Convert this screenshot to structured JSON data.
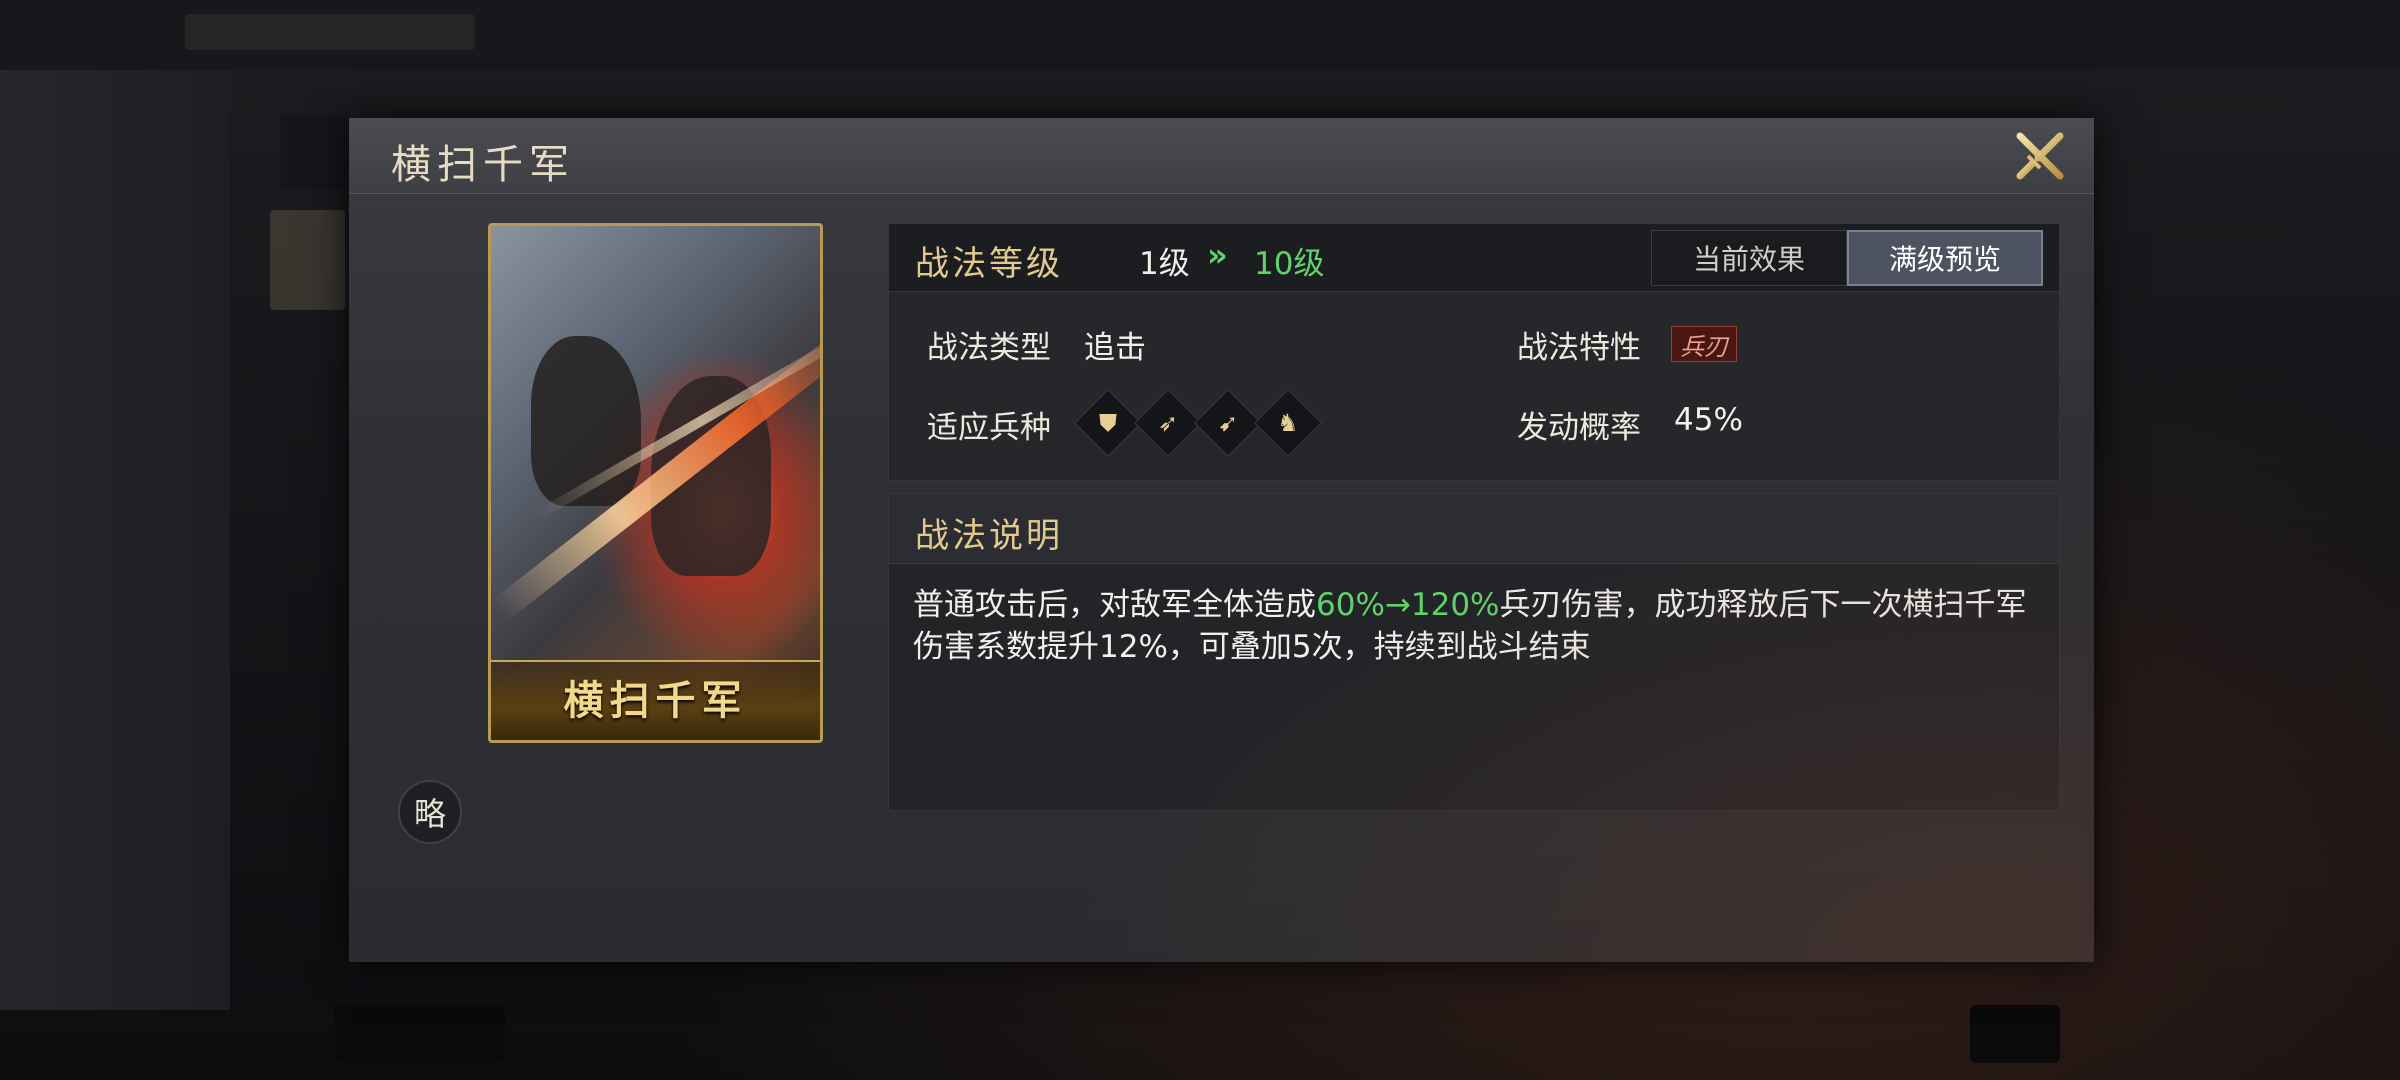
{
  "dialog": {
    "title": "横扫千军",
    "close_icon": "crossed-swords-close-icon"
  },
  "card": {
    "name": "横扫千军"
  },
  "badge": {
    "label": "略"
  },
  "level": {
    "label": "战法等级",
    "from": "1级",
    "arrow": "»",
    "to": "10级"
  },
  "tabs": [
    {
      "label": "当前效果",
      "active": false
    },
    {
      "label": "满级预览",
      "active": true
    }
  ],
  "fields": {
    "type_label": "战法类型",
    "type_value": "追击",
    "trait_label": "战法特性",
    "trait_value": "兵刃",
    "troops_label": "适应兵种",
    "troops": [
      "shield-icon",
      "bow-icon",
      "spear-icon",
      "horse-icon"
    ],
    "rate_label": "发动概率",
    "rate_value": "45%"
  },
  "description": {
    "title": "战法说明",
    "text_before": "普通攻击后，对敌军全体造成",
    "highlight": "60%→120%",
    "text_after": "兵刃伤害，成功释放后下一次横扫千军伤害系数提升12%，可叠加5次，持续到战斗结束"
  },
  "colors": {
    "gold": "#e2c98e",
    "green": "#5fd36a",
    "trait_red": "#4a1612"
  }
}
